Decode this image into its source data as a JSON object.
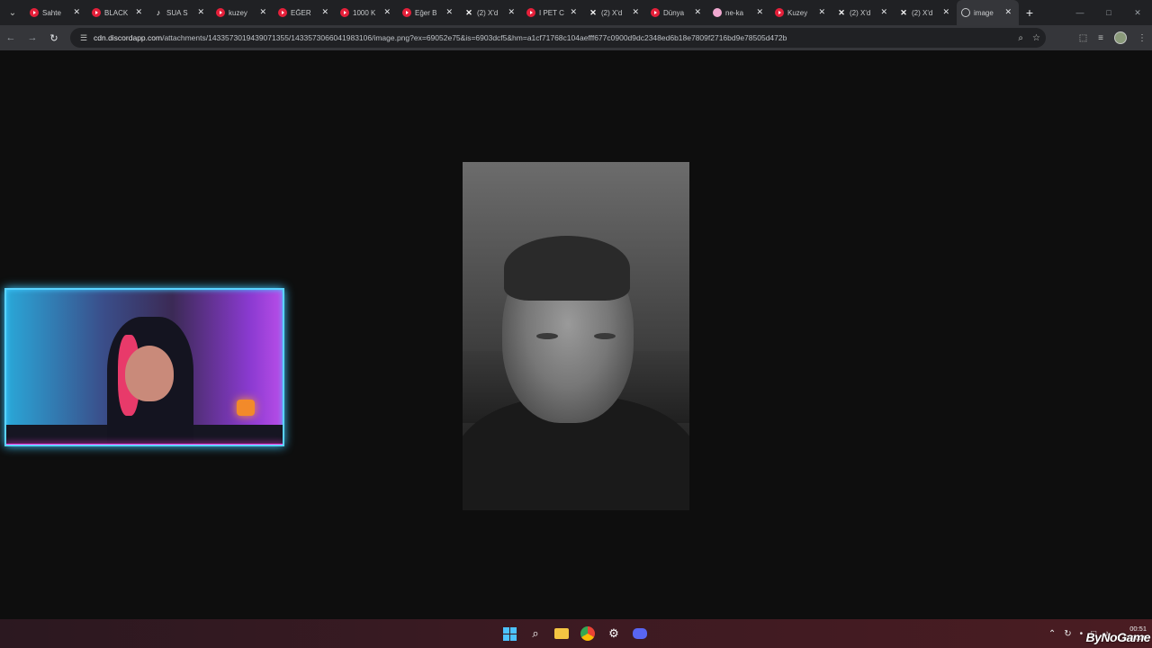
{
  "tabs": [
    {
      "label": "Sahte",
      "favicon": "youtube-icon",
      "kind": "yt"
    },
    {
      "label": "BLACK",
      "favicon": "youtube-icon",
      "kind": "yt"
    },
    {
      "label": "SUA S",
      "favicon": "tiktok-icon",
      "kind": "tt"
    },
    {
      "label": "kuzey",
      "favicon": "youtube-icon",
      "kind": "yt"
    },
    {
      "label": "EĞER",
      "favicon": "youtube-icon",
      "kind": "yt"
    },
    {
      "label": "1000 K",
      "favicon": "youtube-icon",
      "kind": "yt"
    },
    {
      "label": "Eğer B",
      "favicon": "youtube-icon",
      "kind": "yt"
    },
    {
      "label": "(2) X'd",
      "favicon": "x-icon",
      "kind": "x"
    },
    {
      "label": "I PET C",
      "favicon": "youtube-icon",
      "kind": "yt"
    },
    {
      "label": "(2) X'd",
      "favicon": "x-icon",
      "kind": "x"
    },
    {
      "label": "Dünya",
      "favicon": "youtube-icon",
      "kind": "yt"
    },
    {
      "label": "ne-ka",
      "favicon": "web-icon",
      "kind": "pk"
    },
    {
      "label": "Kuzey",
      "favicon": "youtube-icon",
      "kind": "yt"
    },
    {
      "label": "(2) X'd",
      "favicon": "x-icon",
      "kind": "x"
    },
    {
      "label": "(2) X'd",
      "favicon": "x-icon",
      "kind": "x"
    },
    {
      "label": "image",
      "favicon": "globe-icon",
      "kind": "globe",
      "active": true
    }
  ],
  "toolbar": {
    "url_host": "cdn.discordapp.com",
    "url_path": "/attachments/1433573019439071355/1433573066041983106/image.png?ex=69052e75&is=6903dcf5&hm=a1cf71768c104aefff677c0900d9dc2348ed6b18e7809f2716bd9e78505d472b"
  },
  "taskbar": {
    "time": "00:51",
    "date": "1.11.2025"
  },
  "watermark": "ByNoGame",
  "colors": {
    "tabstrip": "#202124",
    "toolbar": "#35363a",
    "page_bg": "#0e0e0e",
    "webcam_border_top": "#5ad3ff",
    "webcam_border_bottom": "#ff3de0"
  }
}
